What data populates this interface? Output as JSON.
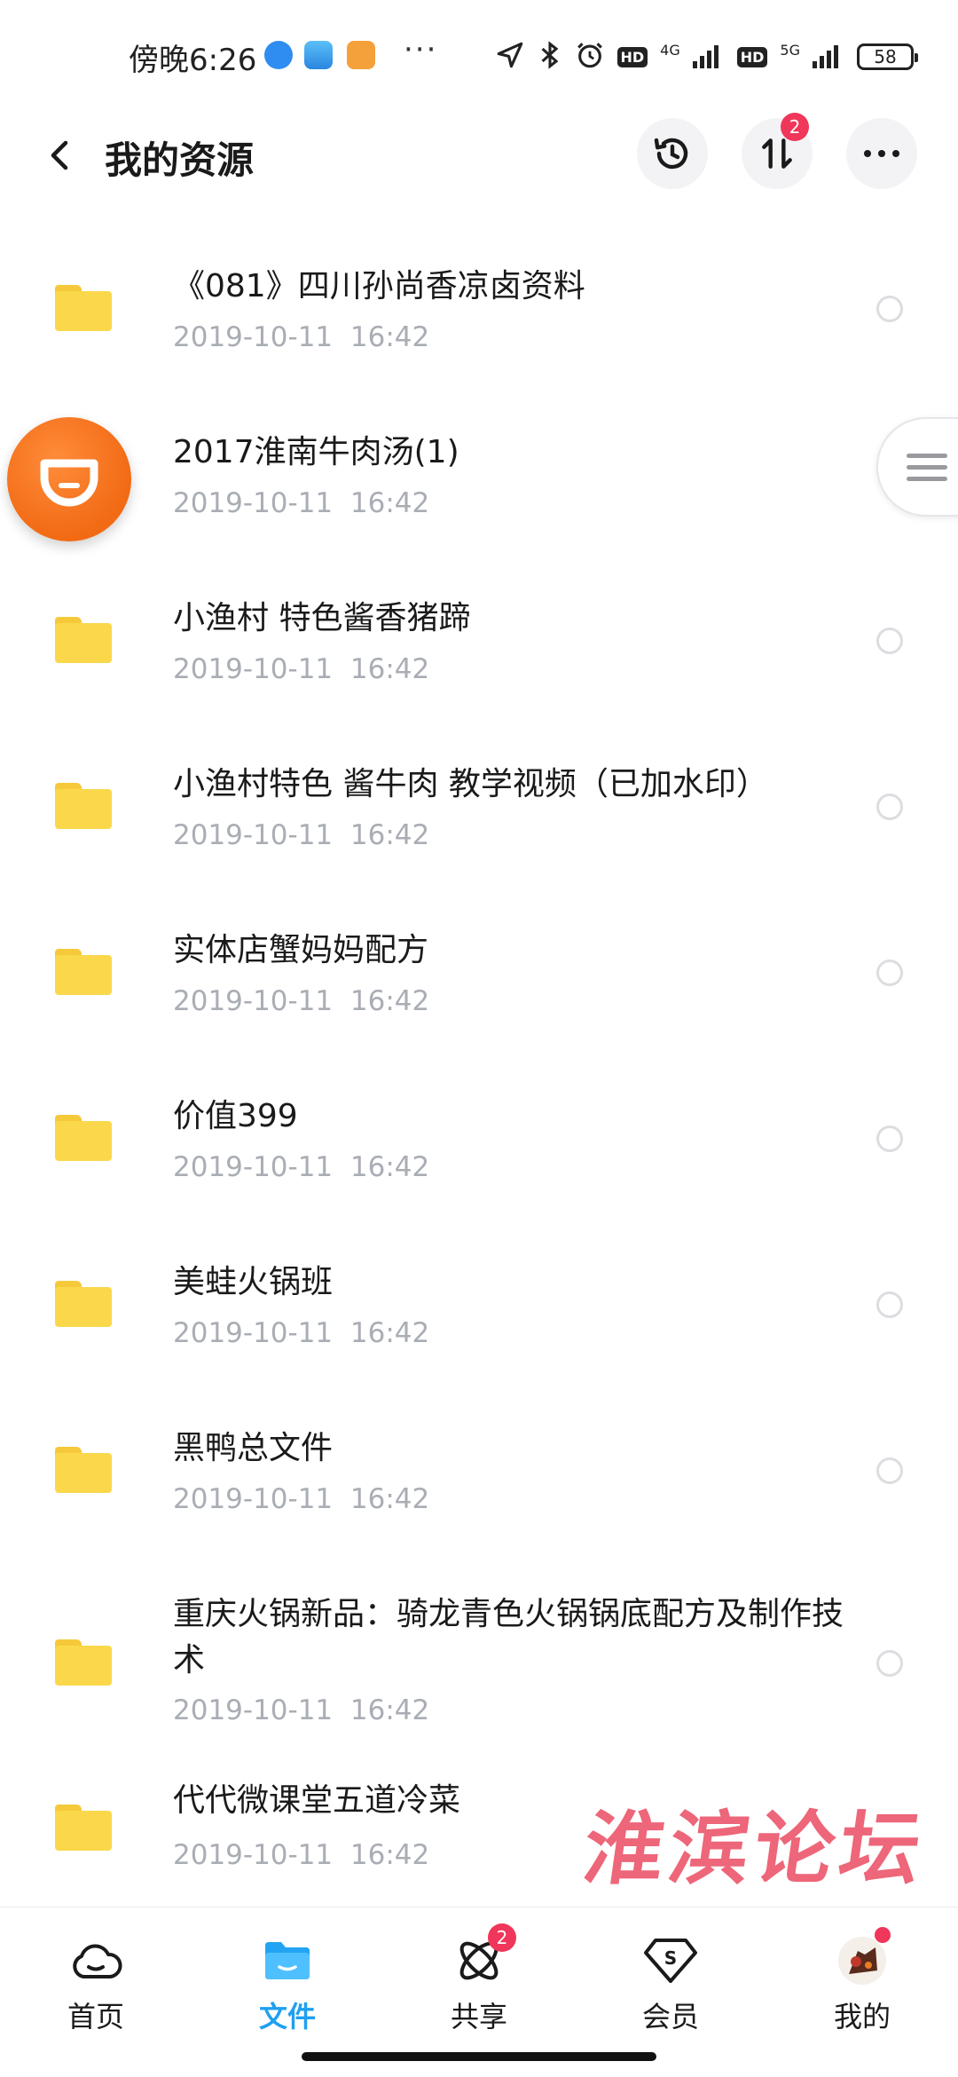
{
  "status_bar": {
    "time": "傍晚6:26",
    "more": "···",
    "network_1": "4G",
    "hd_1": "HD",
    "network_2": "5G",
    "hd_2": "HD",
    "battery": "58"
  },
  "header": {
    "title": "我的资源",
    "transfer_badge": "2"
  },
  "files": [
    {
      "name": "《081》四川孙尚香凉卤资料",
      "date": "2019-10-11",
      "time": "16:42"
    },
    {
      "name": "2017淮南牛肉汤(1)",
      "date": "2019-10-11",
      "time": "16:42"
    },
    {
      "name": "小渔村 特色酱香猪蹄",
      "date": "2019-10-11",
      "time": "16:42"
    },
    {
      "name": "小渔村特色 酱牛肉 教学视频（已加水印）",
      "date": "2019-10-11",
      "time": "16:42"
    },
    {
      "name": "实体店蟹妈妈配方",
      "date": "2019-10-11",
      "time": "16:42"
    },
    {
      "name": "价值399",
      "date": "2019-10-11",
      "time": "16:42"
    },
    {
      "name": "美蛙火锅班",
      "date": "2019-10-11",
      "time": "16:42"
    },
    {
      "name": "黑鸭总文件",
      "date": "2019-10-11",
      "time": "16:42"
    },
    {
      "name": "重庆火锅新品：骑龙青色火锅锅底配方及制作技术",
      "date": "2019-10-11",
      "time": "16:42"
    },
    {
      "name": "代代微课堂五道冷菜",
      "date": "2019-10-11",
      "time": "16:42"
    }
  ],
  "watermark": "淮滨论坛",
  "bottom_nav": {
    "items": [
      {
        "label": "首页",
        "icon": "cloud-home-icon"
      },
      {
        "label": "文件",
        "icon": "folder-icon",
        "active": true
      },
      {
        "label": "共享",
        "icon": "share-atom-icon",
        "badge": "2"
      },
      {
        "label": "会员",
        "icon": "vip-diamond-icon"
      },
      {
        "label": "我的",
        "icon": "avatar-icon"
      }
    ]
  },
  "colors": {
    "accent": "#1fa0f0",
    "badge": "#f0365a",
    "folder": "#fbd84b",
    "meta_text": "#a9adb4",
    "didi_orange": "#f26a14",
    "watermark": "#ec5a6e"
  }
}
